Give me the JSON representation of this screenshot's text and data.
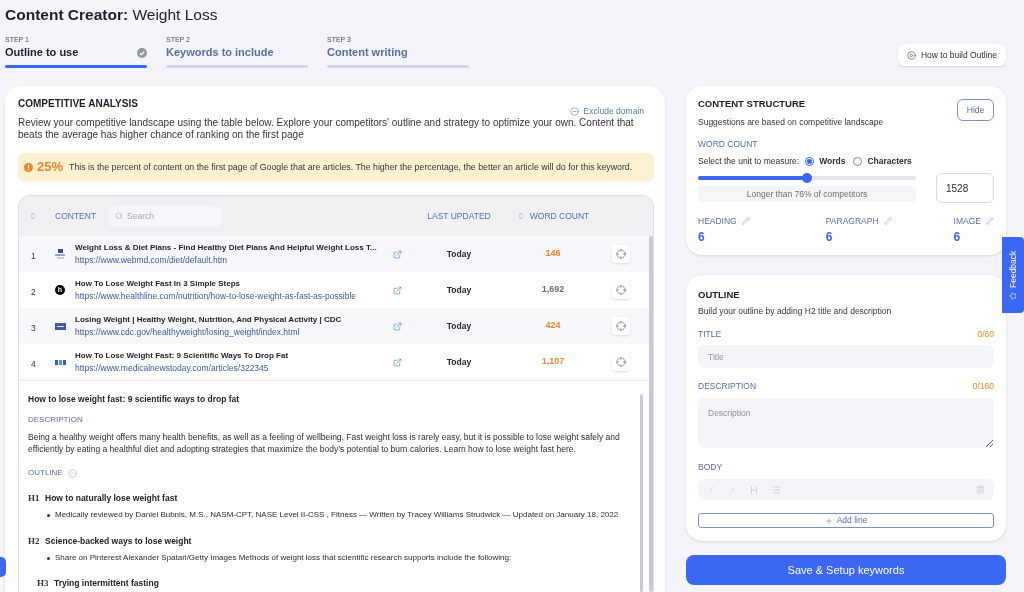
{
  "page": {
    "title": "**Content Creator:** Weight Loss"
  },
  "steps": [
    {
      "step": "STEP 1",
      "label": "Outline to use",
      "selected": true,
      "done": true
    },
    {
      "step": "STEP 2",
      "label": "Keywords to include",
      "selected": false,
      "done": false
    },
    {
      "step": "STEP 3",
      "label": "Content writing",
      "selected": false,
      "done": false
    }
  ],
  "help_button": {
    "label": "How to build Outline"
  },
  "competitive_analysis": {
    "title": "COMPETITIVE ANALYSIS",
    "exclude_link": "Exclude domain",
    "description": "Review your competitive landscape using the table below. Explore your competitors' outline and strategy to optimize your own. Content that beats the average has higher chance of ranking on the first page",
    "alert": {
      "percent": "25%",
      "text": "This is the percent of content on the first page of Google that are articles. The higher the percentage, the better an article will do for this keyword."
    },
    "table": {
      "columns": [
        {
          "kind": "rank",
          "sortable": true
        },
        {
          "kind": "content",
          "label": "CONTENT",
          "sortable": false
        },
        {
          "kind": "updated",
          "label": "LAST UPDATED",
          "sortable": false
        },
        {
          "kind": "words",
          "label": "WORD COUNT",
          "sortable": true
        }
      ],
      "search": {
        "placeholder": "Search"
      },
      "rows": [
        {
          "rank": "1",
          "favicon": {
            "kind": "stack"
          },
          "title": "Weight Loss & Diet Plans - Find Healthy Diet Plans And Helpful Weight Loss T...",
          "url": "https://www.webmd.com/diet/default.htm",
          "updated": "Today",
          "word_count": "146",
          "color": "#f0832b"
        },
        {
          "rank": "2",
          "favicon": {
            "kind": "letter",
            "text": "h"
          },
          "title": "How To Lose Weight Fast In 3 Simple Steps",
          "url": "https://www.healthline.com/nutrition/how-to-lose-weight-as-fast-as-possible",
          "updated": "Today",
          "word_count": "1,692",
          "color": "#6b6e76"
        },
        {
          "rank": "3",
          "favicon": {
            "kind": "badge"
          },
          "title": "Losing Weight | Healthy Weight, Nutrition, And Physical Activity | CDC",
          "url": "https://www.cdc.gov/healthyweight/losing_weight/index.html",
          "updated": "Today",
          "word_count": "424",
          "color": "#f0832b"
        },
        {
          "rank": "4",
          "favicon": {
            "kind": "tiles"
          },
          "title": "How To Lose Weight Fast: 9 Scientific Ways To Drop Fat",
          "url": "https://www.medicalnewstoday.com/articles/322345",
          "updated": "Today",
          "word_count": "1,107",
          "color": "#f0832b"
        }
      ]
    },
    "detail": {
      "title": "How to lose weight fast: 9 scientific ways to drop fat",
      "description_label": "DESCRIPTION",
      "description": "Being a healthy weight offers many health benefits, as well as a feeling of wellbeing. Fast weight loss is rarely easy, but it is possible to lose weight safely and efficiently by eating a healthful diet and adopting strategies that maximize the body’s potential to burn calories. Learn how to lose weight fast here.",
      "outline_label": "OUTLINE",
      "outline_expanded": true,
      "outline": [
        {
          "kind": "heading",
          "tag": "H1",
          "text": "How to naturally lose weight fast",
          "children": [
            {
              "kind": "bullet",
              "text": "Medically reviewed by Daniel Bubnis, M.S., NASM-CPT, NASE Level II-CSS , Fitness — Written by Tracey Williams Strudwick — Updated on January 18, 2022"
            }
          ]
        },
        {
          "kind": "heading",
          "tag": "H2",
          "text": "Science-backed ways to lose weight",
          "children": [
            {
              "kind": "bullet",
              "text": "Share on Pinterest Alexander Spatari/Getty Images Methods of weight loss that scientific research supports include the following:"
            },
            {
              "kind": "heading",
              "tag": "H3",
              "text": "Trying intermittent fasting"
            }
          ]
        }
      ]
    }
  },
  "content_structure": {
    "title": "CONTENT STRUCTURE",
    "subtitle": "Suggestions are based on competitive landscape",
    "hide_button": "Hide",
    "word_count": {
      "label": "WORD COUNT",
      "prompt": "Select the unit to measure:",
      "units": [
        {
          "label": "Words",
          "selected": true
        },
        {
          "label": "Characters",
          "selected": false
        }
      ],
      "level": 0.5,
      "comparison": "Longer than 76% of competitors",
      "value": "1528"
    },
    "metrics": [
      {
        "label": "HEADING",
        "value": "6"
      },
      {
        "label": "PARAGRAPH",
        "value": "6"
      },
      {
        "label": "IMAGE",
        "value": "6"
      }
    ]
  },
  "outline": {
    "title": "OUTLINE",
    "subtitle": "Build your outline by adding H2 title and description",
    "fields": [
      {
        "kind": "input",
        "label": "TITLE",
        "counter": "0/60",
        "placeholder": "Title"
      },
      {
        "kind": "textarea",
        "label": "DESCRIPTION",
        "counter": "0/160",
        "placeholder": "Description"
      }
    ],
    "body": {
      "label": "BODY",
      "disabled": true
    },
    "add_button": "Add line"
  },
  "save_button": {
    "label": "Save & Setup keywords"
  },
  "feedback_tab": {
    "label": "Feedback"
  }
}
